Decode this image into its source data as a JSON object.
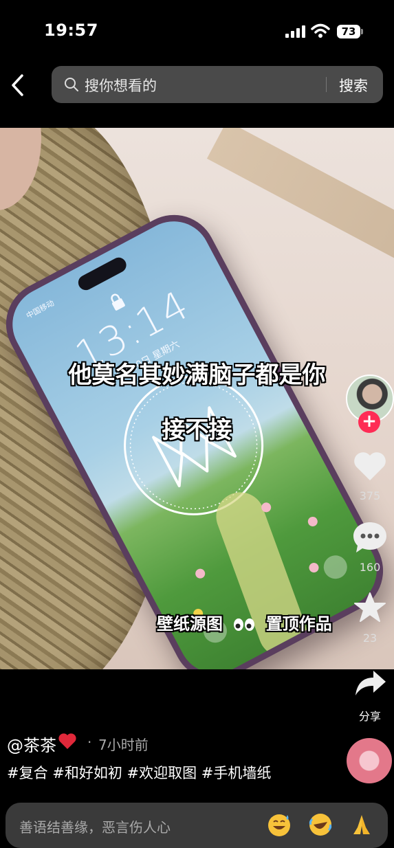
{
  "status_bar": {
    "time": "19:57",
    "battery": "73"
  },
  "search": {
    "placeholder": "搜你想看的",
    "button": "搜索"
  },
  "video": {
    "lock_screen": {
      "carrier": "中国移动",
      "time": "13:14",
      "date": "5月20日 星期六"
    },
    "captions": [
      "他莫名其妙满脑子都是你",
      "接不接"
    ],
    "bottom_caption": {
      "before": "壁纸源图",
      "emoji_icon": "eyes-emoji-icon",
      "after": "置顶作品"
    }
  },
  "actions": {
    "likes": "375",
    "comments": "160",
    "favorites": "23",
    "share": "分享"
  },
  "post": {
    "author": "@茶茶",
    "time": "7小时前",
    "separator": "·",
    "tags": "#复合 #和好如初 #欢迎取图 #手机墙纸"
  },
  "comment": {
    "placeholder": "善语结善缘，恶言伤人心"
  },
  "colors": {
    "accent": "#fe2c55",
    "background": "#000000",
    "search_bg": "#4a4a4a"
  }
}
